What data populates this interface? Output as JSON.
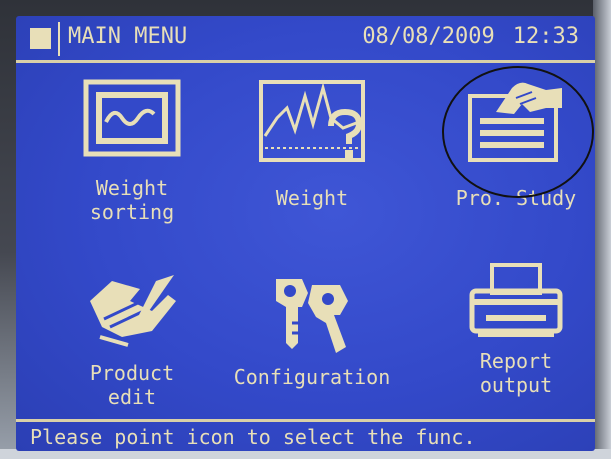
{
  "header": {
    "title": "MAIN MENU",
    "date": "08/08/2009",
    "time": "12:33"
  },
  "tiles": [
    {
      "label": "Weight\nsorting",
      "icon": "waveform-monitor-icon"
    },
    {
      "label": "Weight",
      "icon": "weight-chart-question-icon"
    },
    {
      "label": "Pro. Study",
      "icon": "hand-document-icon"
    },
    {
      "label": "Product\nedit",
      "icon": "hand-writing-icon"
    },
    {
      "label": "Configuration",
      "icon": "keys-icon"
    },
    {
      "label": "Report\noutput",
      "icon": "printer-icon"
    }
  ],
  "status": {
    "message": "Please point icon to select the func."
  },
  "colors": {
    "screen": "#3349c9",
    "foreground": "#e8dfb8",
    "annotation_circle": "#111111"
  }
}
